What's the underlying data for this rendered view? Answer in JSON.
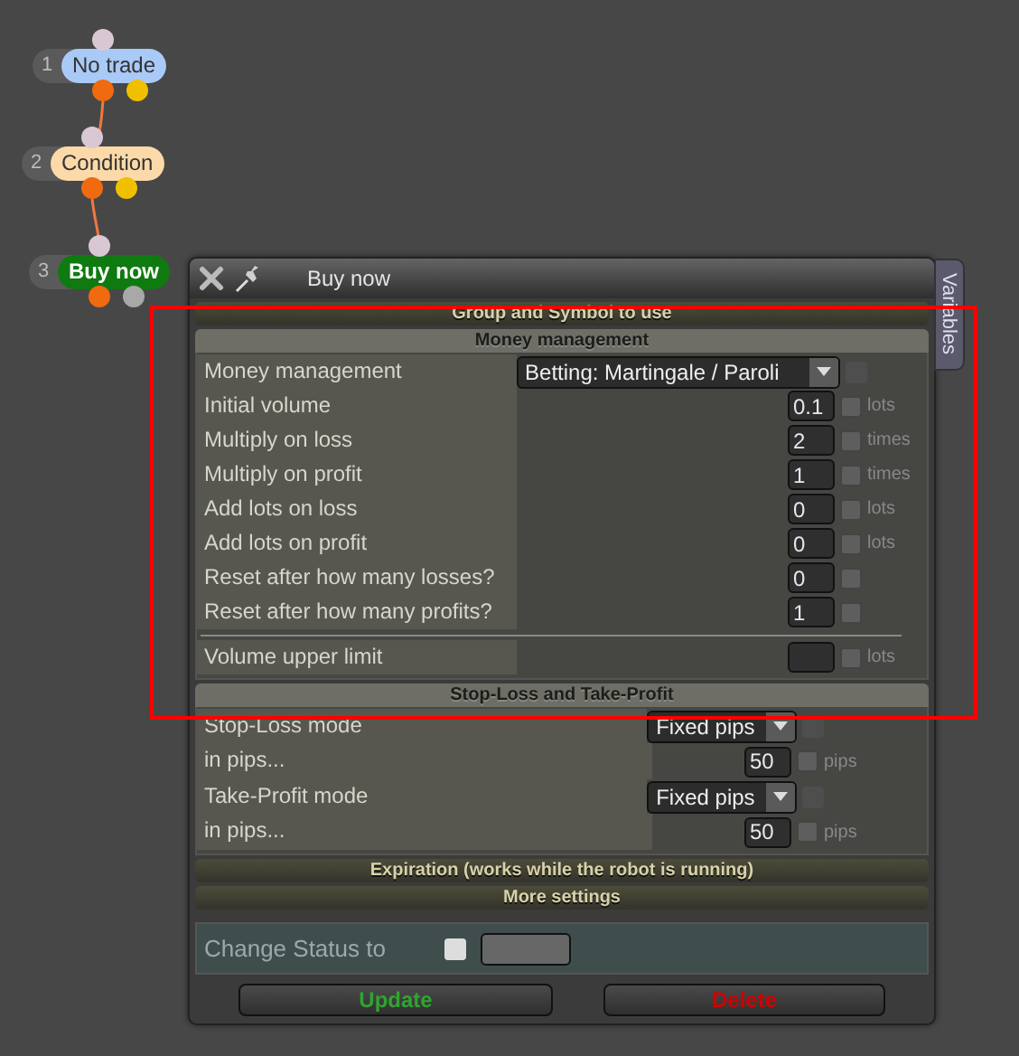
{
  "nodes": [
    {
      "number": "1",
      "label": "No trade",
      "color": "#a9c9f6",
      "ports": [
        {
          "color": "#f06a10"
        },
        {
          "color": "#f0c000"
        }
      ]
    },
    {
      "number": "2",
      "label": "Condition",
      "color": "#fcd9a8",
      "ports": [
        {
          "color": "#f06a10"
        },
        {
          "color": "#f0c000"
        }
      ]
    },
    {
      "number": "3",
      "label": "Buy now",
      "color": "#0f7a0f",
      "ports": [
        {
          "color": "#f06a10"
        },
        {
          "color": "#a8a8a8"
        }
      ]
    }
  ],
  "dialog": {
    "title": "Buy now",
    "side_tab": "Variables",
    "sections": [
      {
        "title": "Group and Symbol to use",
        "expanded": false
      },
      {
        "title": "Money management",
        "expanded": true,
        "kind": "wide",
        "rows": [
          {
            "kind": "select",
            "label": "Money management",
            "value": "Betting: Martingale / Paroli",
            "checked": false,
            "disabled": true
          },
          {
            "kind": "number",
            "label": "Initial volume",
            "value": "0.1",
            "checked": false,
            "unit": "lots"
          },
          {
            "kind": "number",
            "label": "Multiply on loss",
            "value": "2",
            "checked": false,
            "unit": "times"
          },
          {
            "kind": "number",
            "label": "Multiply on profit",
            "value": "1",
            "checked": false,
            "unit": "times"
          },
          {
            "kind": "number",
            "label": "Add lots on loss",
            "value": "0",
            "checked": false,
            "unit": "lots"
          },
          {
            "kind": "number",
            "label": "Add lots on profit",
            "value": "0",
            "checked": false,
            "unit": "lots"
          },
          {
            "kind": "number",
            "label": "Reset after how many losses?",
            "value": "0",
            "checked": false
          },
          {
            "kind": "number",
            "label": "Reset after how many profits?",
            "value": "1",
            "checked": false
          },
          {
            "kind": "divider"
          },
          {
            "kind": "number",
            "label": "Volume upper limit",
            "checked": false,
            "unit": "lots"
          }
        ]
      },
      {
        "title": "Stop-Loss and Take-Profit",
        "expanded": true,
        "kind": "narrow",
        "rows": [
          {
            "kind": "select",
            "label": "Stop-Loss mode",
            "value": "Fixed pips",
            "checked": false,
            "disabled": true
          },
          {
            "kind": "number",
            "label": "in pips...",
            "value": "50",
            "checked": false,
            "unit": "pips"
          },
          {
            "kind": "select",
            "label": "Take-Profit mode",
            "value": "Fixed pips",
            "checked": false,
            "disabled": true
          },
          {
            "kind": "number",
            "label": "in pips...",
            "value": "50",
            "checked": false,
            "unit": "pips"
          }
        ]
      },
      {
        "title": "Expiration (works while the robot is running)",
        "expanded": false
      },
      {
        "title": "More settings",
        "expanded": false
      }
    ],
    "status": {
      "label": "Change Status to",
      "checked": false
    },
    "buttons": [
      {
        "label": "Update",
        "kind": "confirm"
      },
      {
        "label": "Delete",
        "kind": "danger"
      }
    ]
  },
  "annotations": [
    {
      "kind": "rectangle"
    }
  ]
}
